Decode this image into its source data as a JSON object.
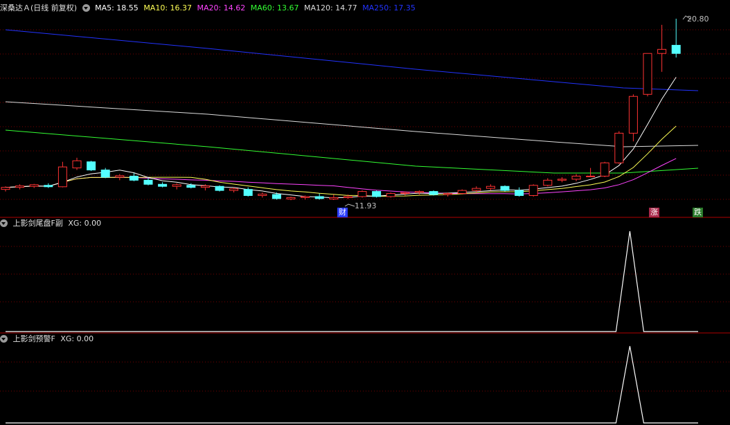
{
  "main": {
    "stock_name": "深桑达Ａ",
    "period": "(日线 前复权)",
    "ma": [
      {
        "label": "MA5: 18.55",
        "color": "#ffffff"
      },
      {
        "label": "MA10: 16.37",
        "color": "#ffff55"
      },
      {
        "label": "MA20: 14.62",
        "color": "#ff44ff"
      },
      {
        "label": "MA60: 13.67",
        "color": "#33ff33"
      },
      {
        "label": "MA120: 14.77",
        "color": "#dddddd"
      },
      {
        "label": "MA250: 17.35",
        "color": "#2233ff"
      }
    ],
    "high_label": "20.80",
    "low_label": "11.93",
    "markers": {
      "cai": "财",
      "zhang": "涨",
      "die": "跌"
    }
  },
  "panel2": {
    "title": "上影剑尾盘F副",
    "value": "XG: 0.00"
  },
  "panel3": {
    "title": "上影剑预警F",
    "value": "XG: 0.00"
  },
  "chart_data": {
    "type": "candlestick",
    "price_range": [
      11.93,
      20.8
    ],
    "candles": [
      [
        12.45,
        12.6,
        12.35,
        12.55
      ],
      [
        12.55,
        12.7,
        12.45,
        12.62
      ],
      [
        12.6,
        12.72,
        12.52,
        12.68
      ],
      [
        12.65,
        12.75,
        12.52,
        12.58
      ],
      [
        12.58,
        13.8,
        12.55,
        13.55
      ],
      [
        13.5,
        14.0,
        13.4,
        13.85
      ],
      [
        13.8,
        13.85,
        13.35,
        13.4
      ],
      [
        13.4,
        13.5,
        13.0,
        13.05
      ],
      [
        13.05,
        13.2,
        12.9,
        13.12
      ],
      [
        13.1,
        13.25,
        12.85,
        12.9
      ],
      [
        12.9,
        13.0,
        12.65,
        12.7
      ],
      [
        12.7,
        12.8,
        12.55,
        12.6
      ],
      [
        12.6,
        12.75,
        12.45,
        12.68
      ],
      [
        12.65,
        12.75,
        12.5,
        12.55
      ],
      [
        12.55,
        12.7,
        12.4,
        12.62
      ],
      [
        12.6,
        12.65,
        12.35,
        12.4
      ],
      [
        12.4,
        12.55,
        12.3,
        12.48
      ],
      [
        12.45,
        12.55,
        12.1,
        12.15
      ],
      [
        12.15,
        12.3,
        12.05,
        12.22
      ],
      [
        12.2,
        12.3,
        11.95,
        12.0
      ],
      [
        11.98,
        12.1,
        11.92,
        12.05
      ],
      [
        12.05,
        12.15,
        11.95,
        12.1
      ],
      [
        12.1,
        12.25,
        11.95,
        12.0
      ],
      [
        11.98,
        12.2,
        11.93,
        12.05
      ],
      [
        12.05,
        12.2,
        11.98,
        12.1
      ],
      [
        12.1,
        12.4,
        12.05,
        12.35
      ],
      [
        12.35,
        12.4,
        12.05,
        12.1
      ],
      [
        12.1,
        12.3,
        12.05,
        12.25
      ],
      [
        12.25,
        12.35,
        12.15,
        12.3
      ],
      [
        12.3,
        12.4,
        12.2,
        12.35
      ],
      [
        12.35,
        12.4,
        12.15,
        12.2
      ],
      [
        12.2,
        12.3,
        12.1,
        12.25
      ],
      [
        12.25,
        12.45,
        12.2,
        12.4
      ],
      [
        12.4,
        12.6,
        12.3,
        12.5
      ],
      [
        12.5,
        12.7,
        12.4,
        12.6
      ],
      [
        12.6,
        12.65,
        12.35,
        12.4
      ],
      [
        12.4,
        12.55,
        12.1,
        12.15
      ],
      [
        12.15,
        12.7,
        12.1,
        12.65
      ],
      [
        12.65,
        13.0,
        12.6,
        12.9
      ],
      [
        12.9,
        13.05,
        12.8,
        12.95
      ],
      [
        12.95,
        13.2,
        12.85,
        13.1
      ],
      [
        13.1,
        13.5,
        13.05,
        13.1
      ],
      [
        13.1,
        13.8,
        13.05,
        13.75
      ],
      [
        13.75,
        15.3,
        13.7,
        15.2
      ],
      [
        15.2,
        17.1,
        14.8,
        17.0
      ],
      [
        17.1,
        19.1,
        17.0,
        19.1
      ],
      [
        19.1,
        20.5,
        18.2,
        19.3
      ],
      [
        19.5,
        20.8,
        18.9,
        19.1
      ]
    ],
    "xg_signal_index": 44
  }
}
